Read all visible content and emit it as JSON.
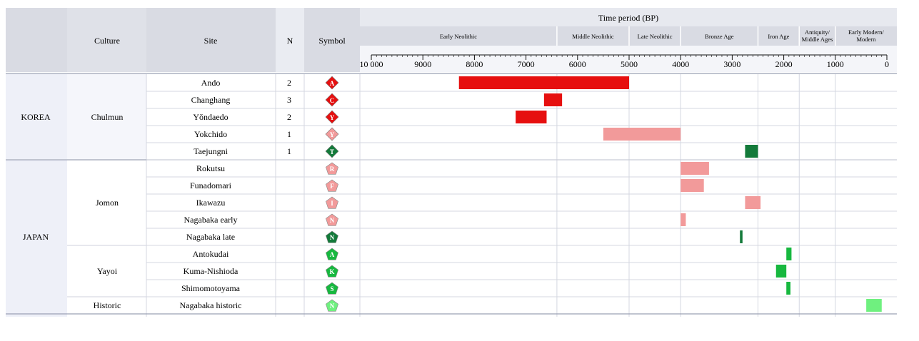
{
  "header": {
    "culture": "Culture",
    "site": "Site",
    "n": "N",
    "symbol": "Symbol",
    "time_period": "Time period (BP)",
    "periods": [
      "Early Neolithic",
      "Middle Neolithic",
      "Late Neolithic",
      "Bronze Age",
      "Iron Age",
      "Antiquity/ Middle Ages",
      "Early Modern/ Modern"
    ]
  },
  "colors": {
    "dark_red": "#e60f0f",
    "light_red": "#f29a9a",
    "dark_green": "#137a3a",
    "mid_green": "#17b83f",
    "light_green": "#6ff07f",
    "header_bg": "#d9dbe3",
    "region_bg": "#eef0f8"
  },
  "regions": [
    {
      "name": "KOREA",
      "cultures": [
        {
          "name": "Chulmun",
          "sites": [
            {
              "site": "Ando",
              "n": "2",
              "letter": "A",
              "shape": "diamond",
              "color": "dark_red"
            },
            {
              "site": "Changhang",
              "n": "3",
              "letter": "C",
              "shape": "diamond",
              "color": "dark_red"
            },
            {
              "site": "Yŏndaedo",
              "n": "2",
              "letter": "Y",
              "shape": "diamond",
              "color": "dark_red"
            },
            {
              "site": "Yokchido",
              "n": "1",
              "letter": "Y",
              "shape": "diamond",
              "color": "light_red"
            },
            {
              "site": "Taejungni",
              "n": "1",
              "letter": "T",
              "shape": "diamond",
              "color": "dark_green"
            }
          ]
        }
      ]
    },
    {
      "name": "JAPAN",
      "cultures": [
        {
          "name": "Jomon",
          "sites": [
            {
              "site": "Rokutsu",
              "n": "",
              "letter": "R",
              "shape": "pentagon",
              "color": "light_red"
            },
            {
              "site": "Funadomari",
              "n": "",
              "letter": "F",
              "shape": "pentagon",
              "color": "light_red"
            },
            {
              "site": "Ikawazu",
              "n": "",
              "letter": "I",
              "shape": "pentagon",
              "color": "light_red"
            },
            {
              "site": "Nagabaka early",
              "n": "",
              "letter": "N",
              "shape": "pentagon",
              "color": "light_red"
            },
            {
              "site": "Nagabaka late",
              "n": "",
              "letter": "N",
              "shape": "pentagon",
              "color": "dark_green"
            }
          ]
        },
        {
          "name": "Yayoi",
          "sites": [
            {
              "site": "Antokudai",
              "n": "",
              "letter": "A",
              "shape": "pentagon",
              "color": "mid_green"
            },
            {
              "site": "Kuma-Nishioda",
              "n": "",
              "letter": "K",
              "shape": "pentagon",
              "color": "mid_green"
            },
            {
              "site": "Shimomotoyama",
              "n": "",
              "letter": "S",
              "shape": "pentagon",
              "color": "mid_green"
            }
          ]
        },
        {
          "name": "Historic",
          "sites": [
            {
              "site": "Nagabaka historic",
              "n": "",
              "letter": "N",
              "shape": "pentagon",
              "color": "light_green"
            }
          ]
        }
      ]
    }
  ],
  "chart_data": {
    "type": "bar",
    "xlabel": "Time period (BP)",
    "xlim": [
      10000,
      0
    ],
    "ticks": [
      "10 000",
      "9000",
      "8000",
      "7000",
      "6000",
      "5000",
      "4000",
      "3000",
      "2000",
      "1000",
      "0"
    ],
    "tick_values": [
      10000,
      9000,
      8000,
      7000,
      6000,
      5000,
      4000,
      3000,
      2000,
      1000,
      0
    ],
    "period_boundaries": [
      6400,
      5000,
      4000,
      2500,
      1700,
      1000
    ],
    "bars": [
      {
        "site": "Ando",
        "start": 8300,
        "end": 5000,
        "color": "dark_red"
      },
      {
        "site": "Changhang",
        "start": 6650,
        "end": 6300,
        "color": "dark_red"
      },
      {
        "site": "Yŏndaedo",
        "start": 7200,
        "end": 6600,
        "color": "dark_red"
      },
      {
        "site": "Yokchido",
        "start": 5500,
        "end": 4000,
        "color": "light_red"
      },
      {
        "site": "Taejungni",
        "start": 2750,
        "end": 2500,
        "color": "dark_green"
      },
      {
        "site": "Rokutsu",
        "start": 4000,
        "end": 3450,
        "color": "light_red"
      },
      {
        "site": "Funadomari",
        "start": 4000,
        "end": 3550,
        "color": "light_red"
      },
      {
        "site": "Ikawazu",
        "start": 2750,
        "end": 2450,
        "color": "light_red"
      },
      {
        "site": "Nagabaka early",
        "start": 4000,
        "end": 3900,
        "color": "light_red"
      },
      {
        "site": "Nagabaka late",
        "start": 2850,
        "end": 2800,
        "color": "dark_green"
      },
      {
        "site": "Antokudai",
        "start": 1950,
        "end": 1850,
        "color": "mid_green"
      },
      {
        "site": "Kuma-Nishioda",
        "start": 2150,
        "end": 1950,
        "color": "mid_green"
      },
      {
        "site": "Shimomotoyama",
        "start": 1950,
        "end": 1870,
        "color": "mid_green"
      },
      {
        "site": "Nagabaka historic",
        "start": 400,
        "end": 100,
        "color": "light_green"
      }
    ]
  }
}
